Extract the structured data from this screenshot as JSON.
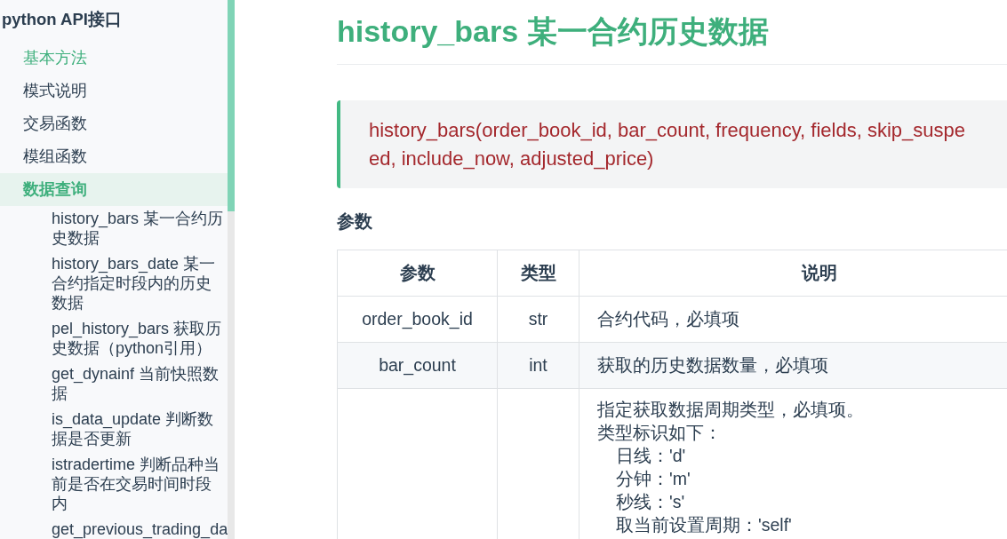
{
  "sidebar": {
    "heading": "python API接口",
    "items": [
      {
        "label": "基本方法",
        "selected": false,
        "hovered": true
      },
      {
        "label": "模式说明",
        "selected": false,
        "hovered": false
      },
      {
        "label": "交易函数",
        "selected": false,
        "hovered": false
      },
      {
        "label": "模组函数",
        "selected": false,
        "hovered": false
      },
      {
        "label": "数据查询",
        "selected": true,
        "hovered": false,
        "children": [
          {
            "label": "history_bars 某一合约历史数据",
            "selected": false
          },
          {
            "label": "history_bars_date 某一合约指定时段内的历史数据",
            "selected": false
          },
          {
            "label": "pel_history_bars 获取历史数据（python引用）",
            "selected": false
          },
          {
            "label": "get_dynainf 当前快照数据",
            "selected": false
          },
          {
            "label": "is_data_update 判断数据是否更新",
            "selected": false
          },
          {
            "label": "istradertime 判断品种当前是否在交易时间时段内",
            "selected": false
          },
          {
            "label": "get_previous_trading_da",
            "selected": false
          }
        ]
      }
    ]
  },
  "page": {
    "title": "history_bars 某一合约历史数据",
    "signature": [
      "history_bars(order_book_id, bar_count, frequency, fields, skip_suspe",
      "ed, include_now, adjusted_price)"
    ],
    "section_heading": "参数",
    "table": {
      "columns": [
        "参数",
        "类型",
        "说明"
      ],
      "rows": [
        {
          "name": "order_book_id",
          "type": "str",
          "description": [
            {
              "text": "合约代码，必填项"
            }
          ]
        },
        {
          "name": "bar_count",
          "type": "int",
          "description": [
            {
              "text": "获取的历史数据数量，必填项"
            }
          ]
        },
        {
          "description": [
            {
              "text": "指定获取数据周期类型，必填项。"
            },
            {
              "text": "类型标识如下：",
              "children": [
                {
                  "text": "日线：'d'"
                },
                {
                  "text": "分钟：'m'"
                },
                {
                  "text": "秒线：'s'"
                },
                {
                  "text": "取当前设置周期：'self'"
                }
              ]
            }
          ]
        }
      ]
    }
  }
}
